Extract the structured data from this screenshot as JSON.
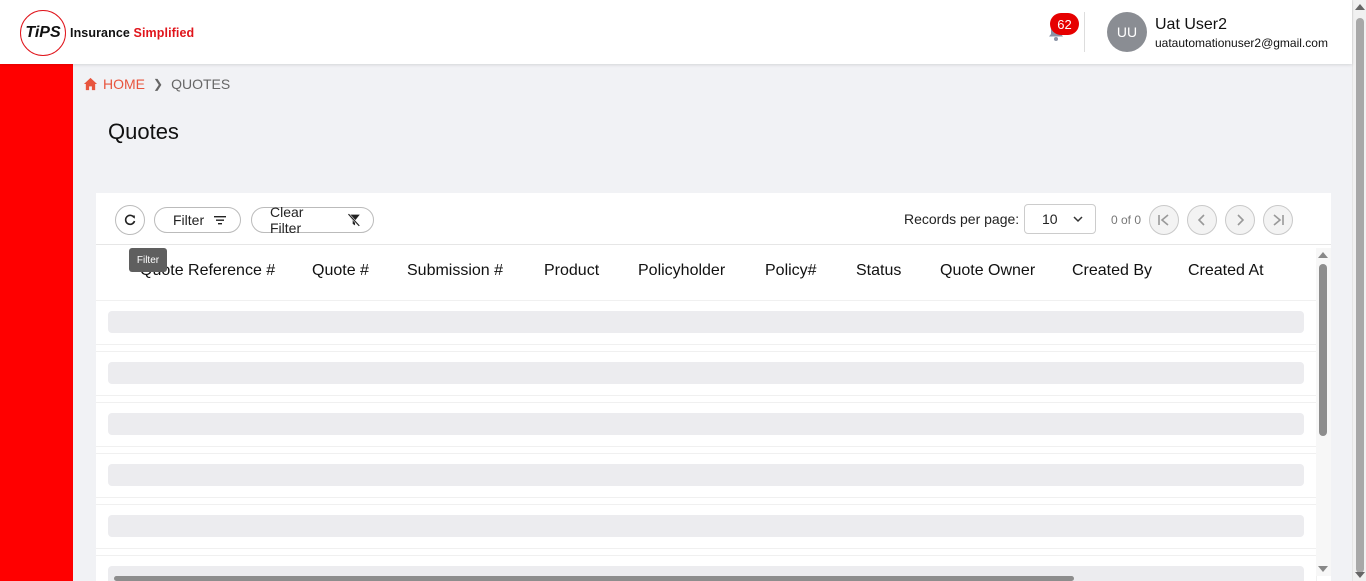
{
  "brand": {
    "logo_letters": "TiPS",
    "tagline_part1": "Insurance",
    "tagline_part2": "Simplified",
    "red": "#e0141b"
  },
  "header": {
    "notification_count": "62",
    "user_initials": "UU",
    "user_name": "Uat User2",
    "user_email": "uatautomationuser2@gmail.com"
  },
  "sidebar": {
    "color": "#ff0000"
  },
  "breadcrumb": {
    "home": "HOME",
    "current": "QUOTES"
  },
  "page": {
    "title": "Quotes"
  },
  "toolbar": {
    "filter_label": "Filter",
    "clear_filter_label": "Clear Filter",
    "records_per_page_label": "Records per page:",
    "records_per_page_value": "10",
    "page_info": "0 of 0",
    "tooltip": "Filter"
  },
  "table": {
    "columns": [
      "Quote Reference #",
      "Quote #",
      "Submission #",
      "Product",
      "Policyholder",
      "Policy#",
      "Status",
      "Quote Owner",
      "Created By",
      "Created At"
    ],
    "loading_rows": 6
  }
}
